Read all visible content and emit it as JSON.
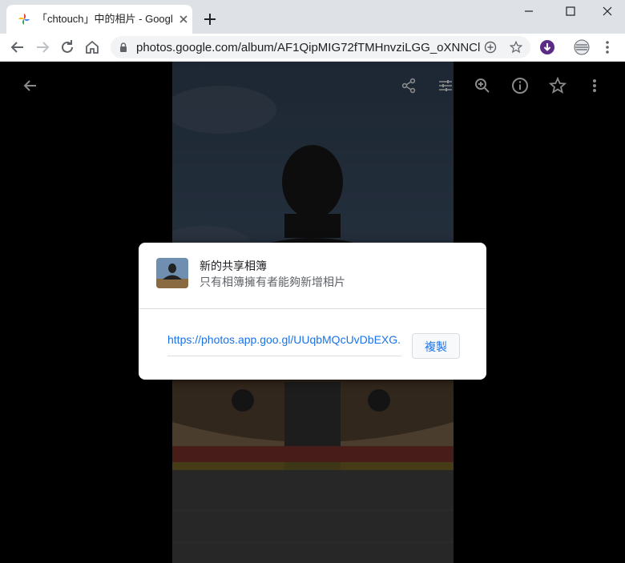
{
  "browser": {
    "tab_title": "「chtouch」中的相片 - Google",
    "url": "photos.google.com/album/AF1QipMIG72fTMHnvziLGG_oXNNCl..."
  },
  "dialog": {
    "title": "新的共享相簿",
    "subtitle": "只有相簿擁有者能夠新增相片",
    "share_link": "https://photos.app.goo.gl/UUqbMQcUvDbEXG...",
    "copy_label": "複製"
  },
  "colors": {
    "link": "#1a73e8",
    "chrome_bg": "#dee1e6",
    "download_badge": "#5b2c86"
  },
  "icons": [
    "photos-logo-icon",
    "close-icon",
    "plus-icon",
    "minimize-icon",
    "maximize-icon",
    "window-close-icon",
    "back-icon",
    "forward-icon",
    "reload-icon",
    "home-icon",
    "lock-icon",
    "add-circle-icon",
    "star-icon",
    "download-icon",
    "extension-icon",
    "menu-icon",
    "share-icon",
    "tune-icon",
    "zoom-in-icon",
    "info-icon"
  ]
}
